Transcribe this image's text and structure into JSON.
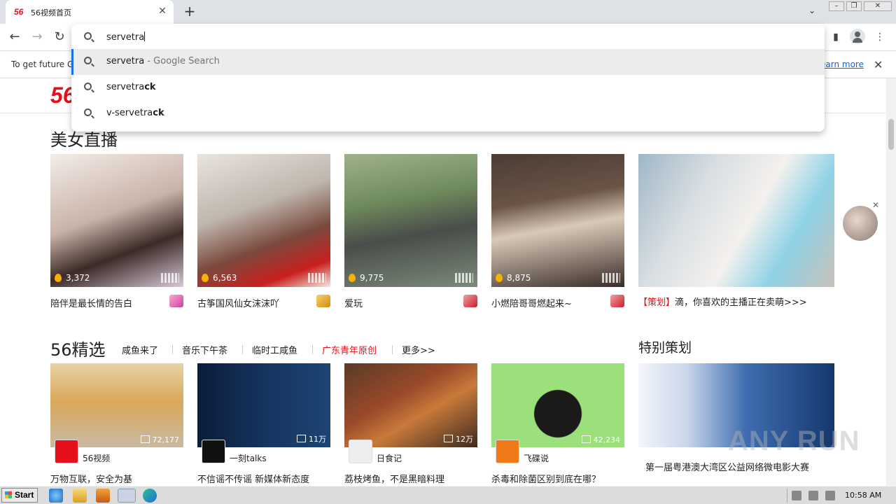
{
  "tab": {
    "favicon": "56",
    "title": "56视频首页"
  },
  "omnibox": {
    "input_value": "servetra",
    "suggestions": [
      {
        "prefix": "servetra",
        "suffix_dim": " - Google Search",
        "bold": ""
      },
      {
        "prefix": "servetra",
        "suffix_dim": "",
        "bold": "ck"
      },
      {
        "prefix": "v-servetra",
        "suffix_dim": "",
        "bold": "ck"
      }
    ]
  },
  "infobar": {
    "text": "To get future G",
    "link": "earn more"
  },
  "page": {
    "logo": "56",
    "live_title": "美女直播",
    "live_cards": [
      {
        "count": "3,372",
        "caption": "陪伴是最长情的告白"
      },
      {
        "count": "6,563",
        "caption": "古筝国风仙女沫沫吖"
      },
      {
        "count": "9,775",
        "caption": "爱玩"
      },
      {
        "count": "8,875",
        "caption": "小燃陪哥哥燃起来~"
      }
    ],
    "promo": {
      "tag": "【策划】",
      "text": "滴，你喜欢的主播正在卖萌>>>"
    },
    "picks_title": "56精选",
    "sub_tabs": [
      "咸鱼来了",
      "音乐下午茶",
      "临时工咸鱼",
      "广东青年原创",
      "更多>>"
    ],
    "special_title": "特别策划",
    "videos": [
      {
        "count": "72,177",
        "channel": "56视频",
        "title": "万物互联，安全为基"
      },
      {
        "count": "11万",
        "channel": "一刻talks",
        "title": "不信谣不传谣 新媒体新态度"
      },
      {
        "count": "12万",
        "channel": "日食记",
        "title": "荔枝烤鱼，不是黑暗料理"
      },
      {
        "count": "42,234",
        "channel": "飞碟说",
        "title": "杀毒和除菌区别到底在哪？"
      }
    ],
    "special_text": "第一届粤港澳大湾区公益网络微电影大赛",
    "watermark": "ANY RUN"
  },
  "taskbar": {
    "start": "Start",
    "clock": "10:58 AM"
  }
}
